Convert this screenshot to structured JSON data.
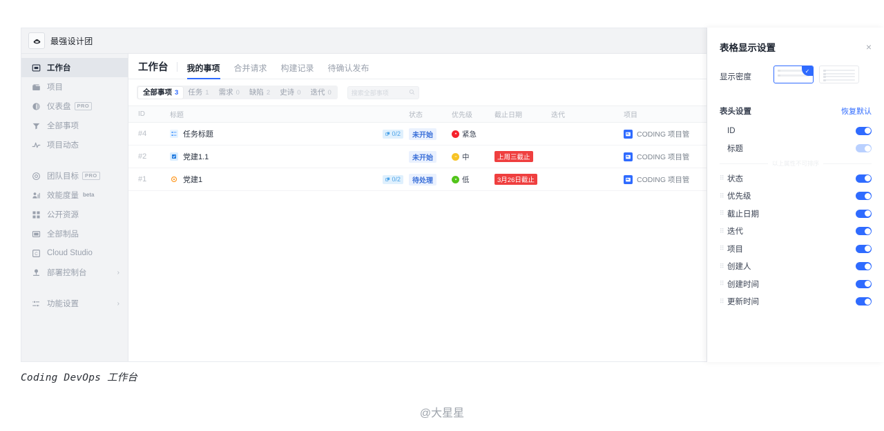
{
  "window": {
    "org_name": "最强设计团",
    "logo_icon": "org-logo-icon"
  },
  "sidebar": {
    "items": [
      {
        "label": "工作台",
        "icon": "workbench-icon",
        "tag": "",
        "chevron": "",
        "active": true
      },
      {
        "label": "项目",
        "icon": "folder-icon",
        "tag": "",
        "chevron": "",
        "active": false
      },
      {
        "label": "仪表盘",
        "icon": "dashboard-icon",
        "tag": "PRO",
        "chevron": "",
        "active": false
      },
      {
        "label": "全部事项",
        "icon": "filter-icon",
        "tag": "",
        "chevron": "",
        "active": false
      },
      {
        "label": "项目动态",
        "icon": "activity-icon",
        "tag": "",
        "chevron": "",
        "active": false
      },
      {
        "label": "团队目标",
        "icon": "target-icon",
        "tag": "PRO",
        "chevron": "",
        "active": false
      },
      {
        "label": "效能度量",
        "icon": "metrics-icon",
        "tag": "beta",
        "chevron": "",
        "active": false
      },
      {
        "label": "公开资源",
        "icon": "resources-icon",
        "tag": "",
        "chevron": "",
        "active": false
      },
      {
        "label": "全部制品",
        "icon": "artifacts-icon",
        "tag": "",
        "chevron": "",
        "active": false
      },
      {
        "label": "Cloud Studio",
        "icon": "cloud-studio-icon",
        "tag": "",
        "chevron": "",
        "active": false
      },
      {
        "label": "部署控制台",
        "icon": "deploy-icon",
        "tag": "",
        "chevron": "›",
        "active": false
      },
      {
        "label": "功能设置",
        "icon": "settings-icon",
        "tag": "",
        "chevron": "›",
        "active": false
      }
    ]
  },
  "main": {
    "page_title": "工作台",
    "tabs": [
      {
        "label": "我的事项",
        "active": true
      },
      {
        "label": "合并请求",
        "active": false
      },
      {
        "label": "构建记录",
        "active": false
      },
      {
        "label": "待确认发布",
        "active": false
      }
    ],
    "filters": [
      {
        "label": "全部事项",
        "count": "3",
        "active": true
      },
      {
        "label": "任务",
        "count": "1",
        "active": false
      },
      {
        "label": "需求",
        "count": "0",
        "active": false
      },
      {
        "label": "缺陷",
        "count": "2",
        "active": false
      },
      {
        "label": "史诗",
        "count": "0",
        "active": false
      },
      {
        "label": "迭代",
        "count": "0",
        "active": false
      }
    ],
    "search": {
      "placeholder": "搜索全部事项",
      "icon": "search-icon"
    },
    "table": {
      "columns": [
        "ID",
        "标题",
        "状态",
        "优先级",
        "截止日期",
        "迭代",
        "项目"
      ],
      "rows": [
        {
          "id": "#4",
          "type_icon": "task-icon",
          "title": "任务标题",
          "subtask": "0/2",
          "status": "未开始",
          "priority": "紧急",
          "priority_color": "#f5222d",
          "due": "",
          "iteration": "",
          "project": "CODING 项目管"
        },
        {
          "id": "#2",
          "type_icon": "requirement-icon",
          "title": "党建1.1",
          "subtask": "",
          "status": "未开始",
          "priority": "中",
          "priority_color": "#f7c325",
          "due": "上周三截止",
          "iteration": "",
          "project": "CODING 项目管"
        },
        {
          "id": "#1",
          "type_icon": "bug-icon",
          "title": "党建1",
          "subtask": "0/2",
          "status": "待处理",
          "priority": "低",
          "priority_color": "#52c41a",
          "due": "3月26日截止",
          "iteration": "",
          "project": "CODING 项目管"
        }
      ]
    }
  },
  "panel": {
    "title": "表格显示设置",
    "close_icon": "close-icon",
    "density": {
      "label": "显示密度",
      "options": [
        {
          "name": "comfortable",
          "selected": true
        },
        {
          "name": "compact",
          "selected": false
        }
      ],
      "check_icon": "check-icon"
    },
    "header_settings": {
      "title": "表头设置",
      "restore_label": "恢复默认",
      "divider_note": "以上属性不可排序",
      "items": [
        {
          "label": "ID",
          "on": true,
          "faded": false,
          "draggable": false
        },
        {
          "label": "标题",
          "on": true,
          "faded": true,
          "draggable": false
        },
        {
          "label": "状态",
          "on": true,
          "faded": false,
          "draggable": true
        },
        {
          "label": "优先级",
          "on": true,
          "faded": false,
          "draggable": true
        },
        {
          "label": "截止日期",
          "on": true,
          "faded": false,
          "draggable": true
        },
        {
          "label": "迭代",
          "on": true,
          "faded": false,
          "draggable": true
        },
        {
          "label": "项目",
          "on": true,
          "faded": false,
          "draggable": true
        },
        {
          "label": "创建人",
          "on": true,
          "faded": false,
          "draggable": true
        },
        {
          "label": "创建时间",
          "on": true,
          "faded": false,
          "draggable": true
        },
        {
          "label": "更新时间",
          "on": true,
          "faded": false,
          "draggable": true
        }
      ]
    }
  },
  "caption": "Coding DevOps 工作台",
  "watermark": "@大星星",
  "colors": {
    "accent": "#2f6bff",
    "danger": "#ef3f3f",
    "status_pill_bg": "#eaf1fe",
    "status_pill_text": "#3a6fd8"
  }
}
